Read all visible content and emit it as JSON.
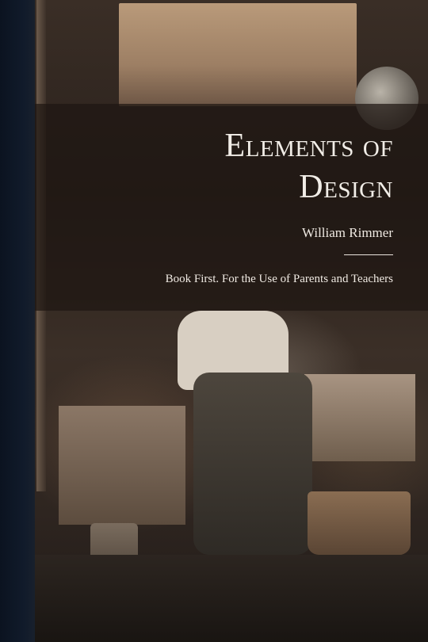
{
  "book": {
    "title_line1": "Elements of",
    "title_line2": "Design",
    "author": "William Rimmer",
    "subtitle": "Book First. For the Use of Parents and Teachers"
  },
  "colors": {
    "spine": "#0b1320",
    "band": "#1e1612",
    "text": "#f1ede7"
  }
}
